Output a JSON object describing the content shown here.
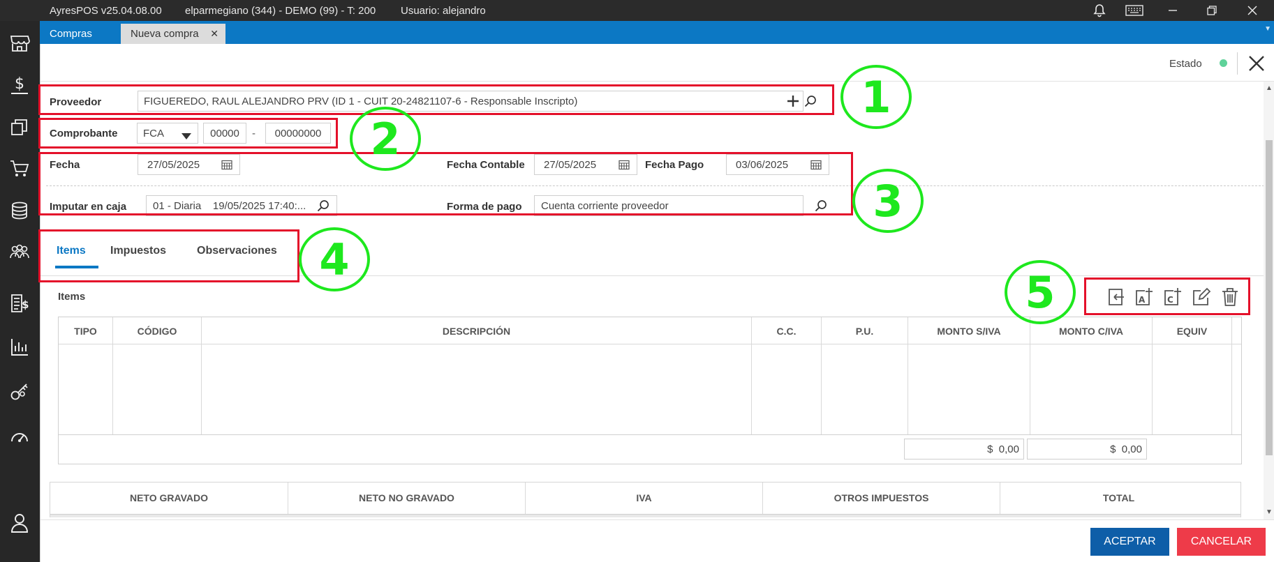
{
  "titlebar": {
    "app": "AyresPOS v25.04.08.00",
    "company": "elparmegiano (344) - DEMO (99) - T: 200",
    "user": "Usuario: alejandro"
  },
  "tabs": [
    {
      "label": "Compras"
    },
    {
      "label": "Nueva compra",
      "close": "✕"
    }
  ],
  "status": {
    "label": "Estado"
  },
  "form": {
    "proveedor_label": "Proveedor",
    "proveedor_value": "FIGUEREDO, RAUL ALEJANDRO PRV (ID 1 - CUIT 20-24821107-6 - Responsable Inscripto)",
    "comprobante_label": "Comprobante",
    "comprobante_type": "FCA",
    "comprobante_pv": "00000",
    "comprobante_sep": "-",
    "comprobante_num": "00000000",
    "fecha_label": "Fecha",
    "fecha_value": "27/05/2025",
    "fecha_contable_label": "Fecha Contable",
    "fecha_contable_value": "27/05/2025",
    "fecha_pago_label": "Fecha Pago",
    "fecha_pago_value": "03/06/2025",
    "imputar_label": "Imputar en caja",
    "imputar_value": "01 - Diaria    19/05/2025 17:40:...",
    "forma_pago_label": "Forma de pago",
    "forma_pago_value": "Cuenta corriente proveedor"
  },
  "section_tabs": [
    "Items",
    "Impuestos",
    "Observaciones"
  ],
  "items": {
    "title": "Items",
    "columns": [
      "TIPO",
      "CÓDIGO",
      "DESCRIPCIÓN",
      "C.C.",
      "P.U.",
      "MONTO S/IVA",
      "MONTO C/IVA",
      "EQUIV"
    ],
    "total_siva": "$  0,00",
    "total_civa": "$  0,00"
  },
  "totals": {
    "columns": [
      "NETO GRAVADO",
      "NETO NO GRAVADO",
      "IVA",
      "OTROS IMPUESTOS",
      "TOTAL"
    ]
  },
  "annotations": [
    "1",
    "2",
    "3",
    "4",
    "5"
  ],
  "buttons": {
    "accept": "ACEPTAR",
    "cancel": "CANCELAR"
  },
  "colors": {
    "accent": "#0c78c4",
    "accept": "#0e5ea8",
    "cancel": "#ee3b49",
    "annotation_box": "#e4102a",
    "annotation_circle": "#1ee81e",
    "status_dot": "#5fd29a"
  },
  "icons": [
    "bell-icon",
    "keyboard-icon",
    "minimize-icon",
    "restore-icon",
    "close-icon",
    "store-icon",
    "dollar-icon",
    "copy-icon",
    "cart-icon",
    "database-icon",
    "users-icon",
    "invoice-icon",
    "chart-icon",
    "keys-icon",
    "gauge-icon",
    "user-icon",
    "plus-icon",
    "search-icon",
    "calendar-icon",
    "dropdown-arrow-icon",
    "import-icon",
    "add-article-icon",
    "add-concept-icon",
    "edit-icon",
    "delete-icon"
  ]
}
